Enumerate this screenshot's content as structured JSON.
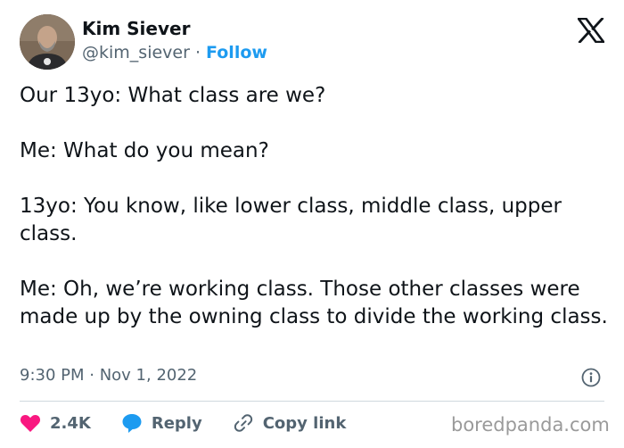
{
  "author": {
    "name": "Kim Siever",
    "handle": "@kim_siever",
    "separator": "·",
    "follow_label": "Follow"
  },
  "tweet": {
    "paragraphs": [
      "Our 13yo: What class are we?",
      "Me: What do you mean?",
      "13yo: You know, like lower class, middle class, upper class.",
      "Me: Oh, we’re working class. Those other classes were made up by the owning class to divide the working class."
    ],
    "timestamp": "9:30 PM · Nov 1, 2022"
  },
  "actions": {
    "like_count": "2.4K",
    "reply_label": "Reply",
    "copy_link_label": "Copy link"
  },
  "watermark": "boredpanda.com",
  "colors": {
    "accent": "#1d9bf0",
    "like": "#f91880",
    "text": "#0f1419",
    "muted": "#536471",
    "divider": "#cfd9de"
  },
  "icons": {
    "brand": "x-logo-icon",
    "info": "info-icon",
    "like": "heart-icon",
    "reply": "speech-bubble-icon",
    "copy": "link-icon"
  }
}
